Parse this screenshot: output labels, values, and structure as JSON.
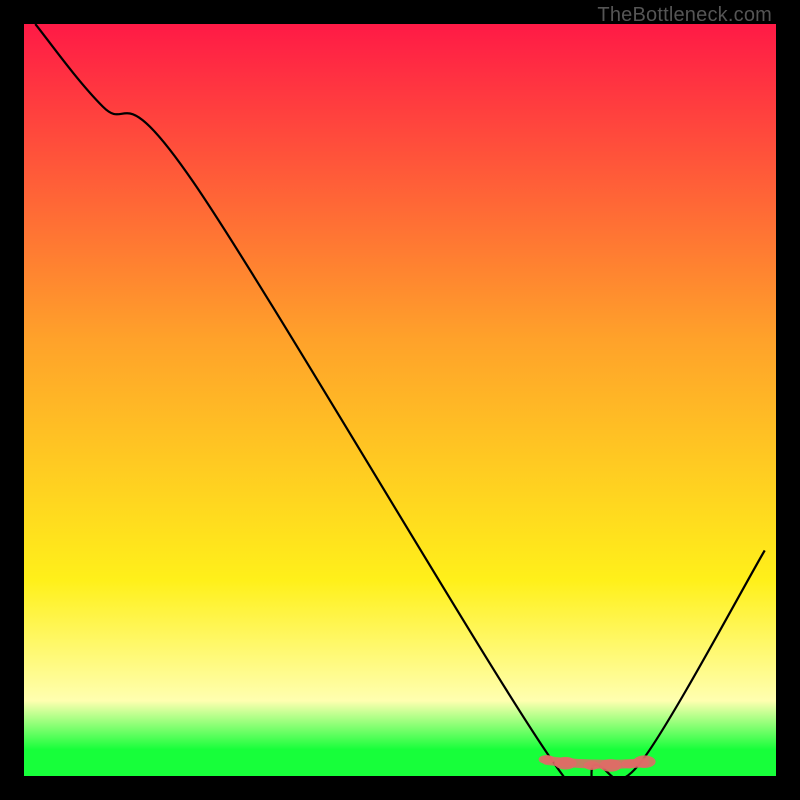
{
  "watermark": "TheBottleneck.com",
  "colors": {
    "black": "#000000",
    "red_top": "#ff1a46",
    "orange": "#ffa22a",
    "yellow": "#fff01a",
    "pale_yellow": "#ffffb0",
    "green": "#17ff3a",
    "curve": "#000000",
    "marker": "#e06a67",
    "watermark": "#555555"
  },
  "chart_data": {
    "type": "line",
    "title": "",
    "xlabel": "",
    "ylabel": "",
    "xlim": [
      0,
      1
    ],
    "ylim": [
      0,
      1
    ],
    "series": [
      {
        "name": "bottleneck-curve",
        "x": [
          0.015,
          0.105,
          0.225,
          0.7,
          0.76,
          0.82,
          0.985
        ],
        "y": [
          1.0,
          0.89,
          0.79,
          0.024,
          0.015,
          0.018,
          0.3
        ]
      },
      {
        "name": "optimal-markers",
        "x": [
          0.695,
          0.72,
          0.755,
          0.78,
          0.805,
          0.825
        ],
        "y": [
          0.022,
          0.017,
          0.014,
          0.014,
          0.016,
          0.019
        ]
      }
    ],
    "gradient_stops": [
      {
        "offset": 0.0,
        "color": "#ff1a46"
      },
      {
        "offset": 0.42,
        "color": "#ffa22a"
      },
      {
        "offset": 0.74,
        "color": "#fff01a"
      },
      {
        "offset": 0.9,
        "color": "#ffffb0"
      },
      {
        "offset": 0.965,
        "color": "#17ff3a"
      },
      {
        "offset": 1.0,
        "color": "#17ff3a"
      }
    ]
  }
}
